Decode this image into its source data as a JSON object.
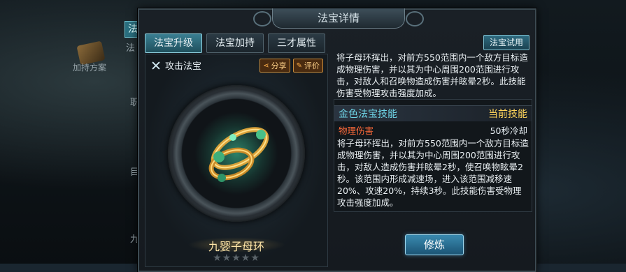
{
  "background": {
    "tab_label": "法",
    "side_label_1": "法",
    "plan_label": "加持方案",
    "side_label_2": "目",
    "side_label_3": "职",
    "side_label_4": "九"
  },
  "dialog": {
    "title": "法宝详情",
    "tabs": [
      {
        "label": "法宝升级",
        "active": true
      },
      {
        "label": "法宝加持",
        "active": false
      },
      {
        "label": "三才属性",
        "active": false
      }
    ],
    "trial_button": "法宝试用"
  },
  "left_panel": {
    "type_label": "攻击法宝",
    "share_button": "分享",
    "review_button": "评价",
    "item_name": "九婴子母环",
    "stars_filled": 0,
    "stars_total": 5,
    "stars_text": "★★★★★"
  },
  "right_panel": {
    "description": "将子母环挥出，对前方550范围内一个敌方目标造成物理伤害，并以其为中心周围200范围进行攻击，对敌人和召唤物造成伤害并眩晕2秒。此技能伤害受物理攻击强度加成。",
    "skill_section_title": "金色法宝技能",
    "skill_current_label": "当前技能",
    "skill_name": "物理伤害",
    "skill_cooldown": "50秒冷却",
    "skill_description": "将子母环挥出，对前方550范围内一个敌方目标造成物理伤害，并以其为中心周围200范围进行攻击，对敌人造成伤害并眩晕2秒，使召唤物眩晕2秒。该范围内形成减速场，进入该范围减移速20%、攻速20%，持续3秒。此技能伤害受物理攻击强度加成。"
  },
  "refine_button": "修炼",
  "colors": {
    "accent_tab": "#3a7f92",
    "skill_title": "#6ed4e6",
    "skill_current": "#ffd45a",
    "skill_name": "#ff6a3a",
    "item_name": "#ffe6a8"
  }
}
